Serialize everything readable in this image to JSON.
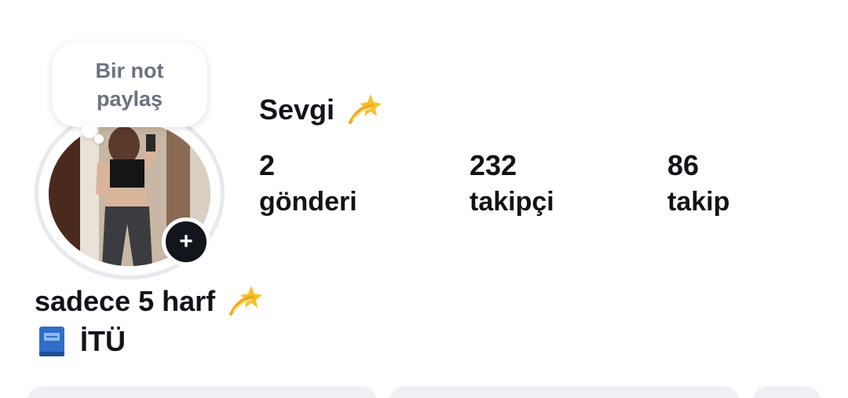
{
  "profile": {
    "display_name": "Sevgi",
    "note_placeholder": "Bir not paylaş",
    "add_story_label": "+"
  },
  "stats": {
    "posts": {
      "value": "2",
      "label": "gönderi"
    },
    "followers": {
      "value": "232",
      "label": "takipçi"
    },
    "following": {
      "value": "86",
      "label": "takip"
    }
  },
  "bio": {
    "line1": "sadece 5 harf",
    "line2": "İTÜ"
  },
  "icons": {
    "name_emoji": "dizzy-sparkle-icon",
    "bio_emoji": "dizzy-sparkle-icon",
    "school_emoji": "blue-book-icon"
  },
  "colors": {
    "text": "#111318",
    "note_text": "#6b7280",
    "ring": "#e6e9ee",
    "add_button": "#12161c",
    "button_bg": "#eef0f3"
  }
}
